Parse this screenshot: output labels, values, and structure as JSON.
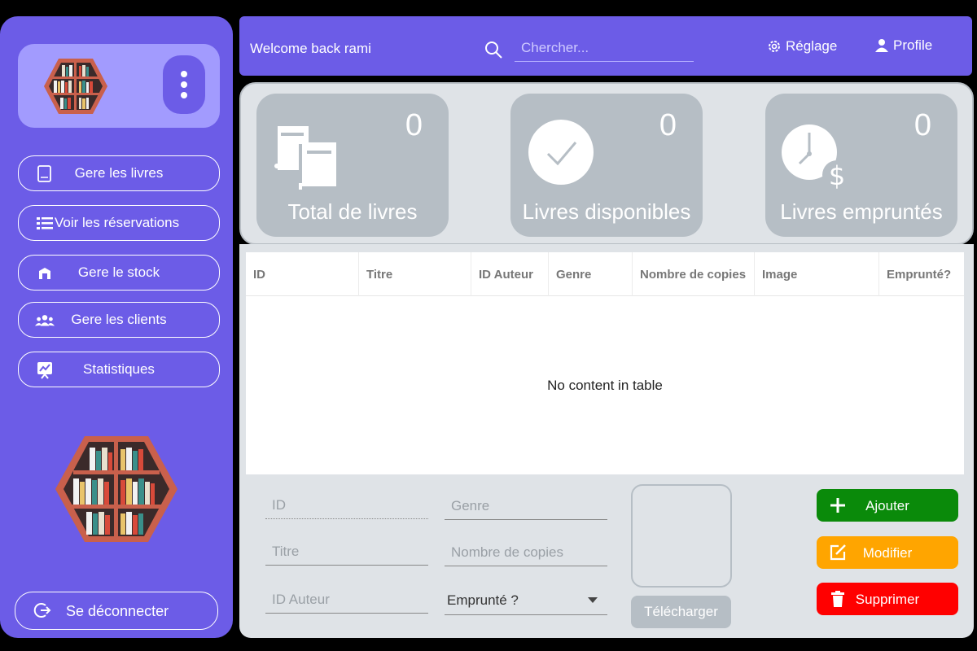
{
  "header": {
    "welcome_text": "Welcome back rami",
    "search_placeholder": "Chercher...",
    "settings_label": "Réglage",
    "profile_label": "Profile"
  },
  "sidebar": {
    "items": [
      {
        "label": "Gere les livres",
        "icon": "book-icon"
      },
      {
        "label": "Voir les réservations",
        "icon": "list-icon"
      },
      {
        "label": "Gere le stock",
        "icon": "warehouse-icon"
      },
      {
        "label": "Gere les clients",
        "icon": "users-icon"
      },
      {
        "label": "Statistiques",
        "icon": "stats-icon"
      }
    ],
    "logout_label": "Se déconnecter"
  },
  "stats": [
    {
      "value": "0",
      "label": "Total de livres",
      "icon": "books-icon"
    },
    {
      "value": "0",
      "label": "Livres disponibles",
      "icon": "check-circle-icon"
    },
    {
      "value": "0",
      "label": "Livres empruntés",
      "icon": "clock-dollar-icon"
    }
  ],
  "table": {
    "columns": [
      "ID",
      "Titre",
      "ID Auteur",
      "Genre",
      "Nombre de copies",
      "Image",
      "Emprunté?"
    ],
    "empty_message": "No content in table"
  },
  "form": {
    "id_placeholder": "ID",
    "titre_placeholder": "Titre",
    "id_auteur_placeholder": "ID Auteur",
    "genre_placeholder": "Genre",
    "copies_placeholder": "Nombre de copies",
    "emprunte_select": "Emprunté ?",
    "upload_label": "Télécharger"
  },
  "actions": {
    "add_label": "Ajouter",
    "edit_label": "Modifier",
    "delete_label": "Supprimer"
  },
  "colors": {
    "primary": "#6c5ce7",
    "primary_light": "#a29bfe",
    "card_gray": "#b6bec5",
    "panel_bg": "#dfe3e7",
    "add_green": "#0a8a0a",
    "edit_orange": "#ffa500",
    "delete_red": "#ff0000"
  }
}
